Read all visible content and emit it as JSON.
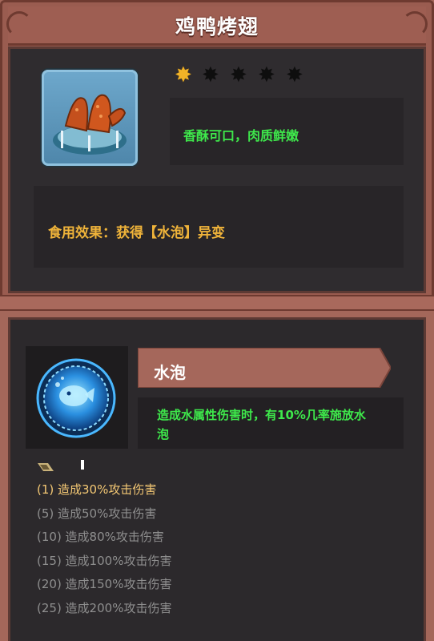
{
  "item": {
    "title": "鸡鸭烤翅",
    "icon": "roast-wings-food-icon",
    "rating": {
      "filled": 1,
      "total": 5
    },
    "description": "香酥可口，肉质鲜嫩",
    "effect": "食用效果：获得【水泡】异变"
  },
  "skill": {
    "icon": "water-bubble-orb-icon",
    "name": "水泡",
    "description": "造成水属性伤害时，有10%几率施放水泡",
    "levels": [
      {
        "text": "(1) 造成30%攻击伤害",
        "active": true
      },
      {
        "text": "(5) 造成50%攻击伤害",
        "active": false
      },
      {
        "text": "(10) 造成80%攻击伤害",
        "active": false
      },
      {
        "text": "(15) 造成100%攻击伤害",
        "active": false
      },
      {
        "text": "(20) 造成150%攻击伤害",
        "active": false
      },
      {
        "text": "(25) 造成200%攻击伤害",
        "active": false
      }
    ]
  },
  "colors": {
    "frame": "#9a5c50",
    "panel": "#2f2c2f",
    "green_text": "#3ee84b",
    "gold_text": "#f0b43a",
    "active_level": "#f4c874",
    "inactive_level": "#8f8f8f"
  }
}
